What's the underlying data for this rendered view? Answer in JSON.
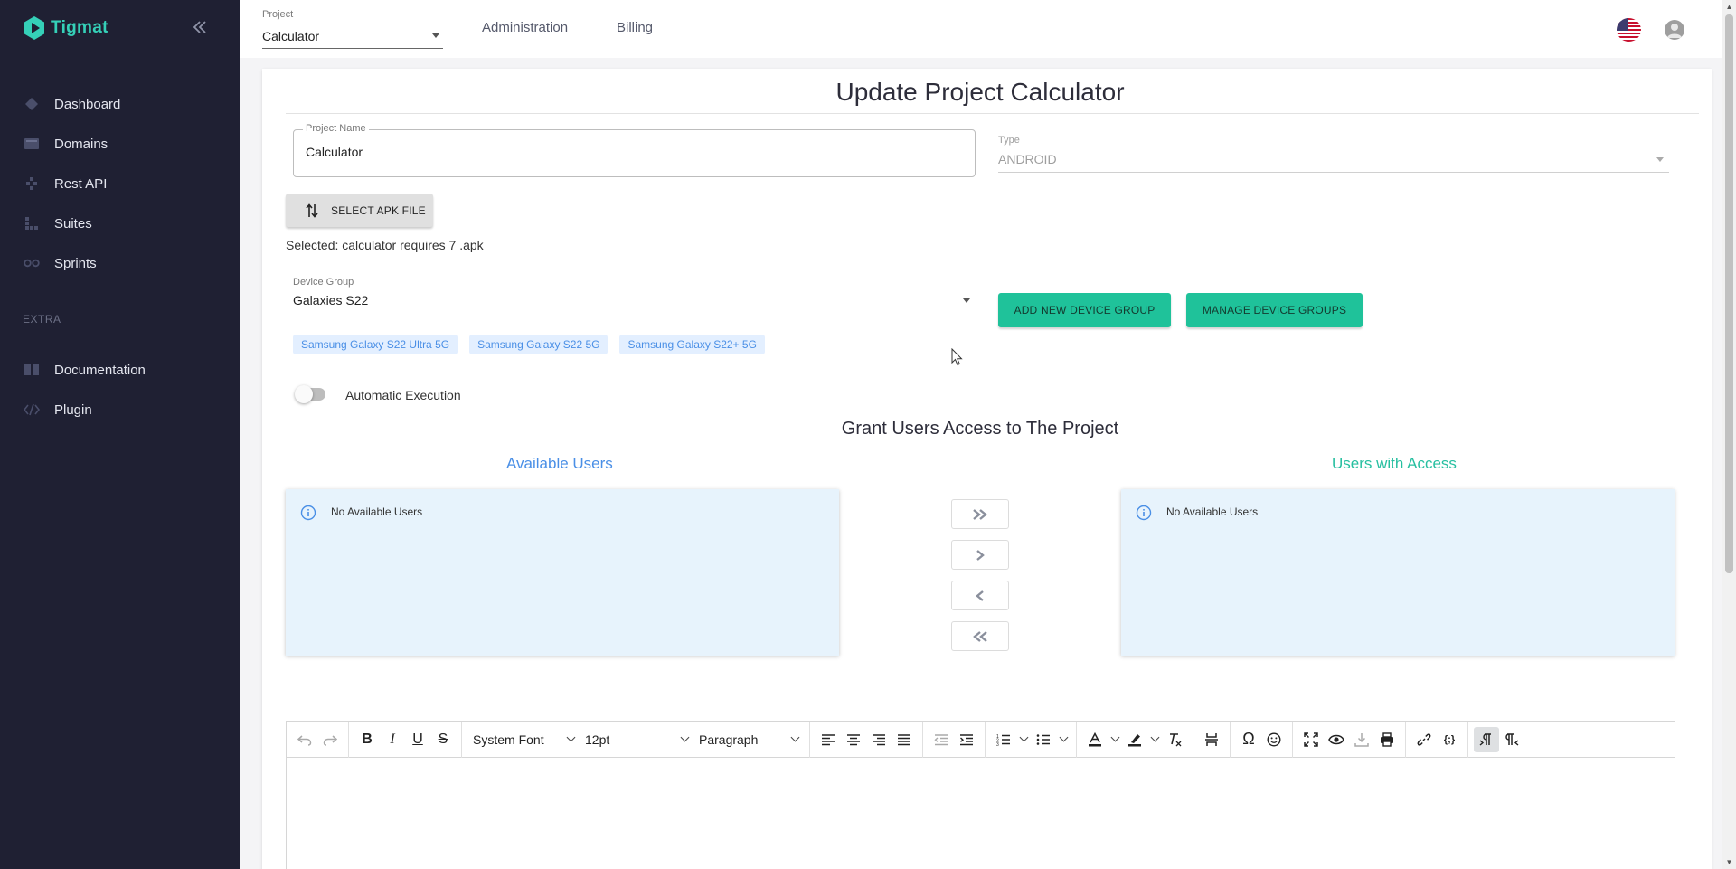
{
  "sidebar": {
    "brand": "Tigmat",
    "items": [
      {
        "label": "Dashboard",
        "icon": "dashboard-icon"
      },
      {
        "label": "Domains",
        "icon": "domains-icon"
      },
      {
        "label": "Rest API",
        "icon": "rest-api-icon"
      },
      {
        "label": "Suites",
        "icon": "suites-icon"
      },
      {
        "label": "Sprints",
        "icon": "sprints-icon"
      }
    ],
    "section_label": "EXTRA",
    "extra_items": [
      {
        "label": "Documentation",
        "icon": "documentation-icon"
      },
      {
        "label": "Plugin",
        "icon": "plugin-icon"
      }
    ]
  },
  "topbar": {
    "project_label": "Project",
    "project_value": "Calculator",
    "links": [
      "Administration",
      "Billing"
    ]
  },
  "form": {
    "title": "Update Project Calculator",
    "project_name_label": "Project Name",
    "project_name_value": "Calculator",
    "type_label": "Type",
    "type_value": "ANDROID",
    "apk_button": "SELECT APK FILE",
    "selected_file": "Selected: calculator requires 7 .apk",
    "device_group_label": "Device Group",
    "device_group_value": "Galaxies S22",
    "add_group_button": "ADD NEW DEVICE GROUP",
    "manage_groups_button": "MANAGE DEVICE GROUPS",
    "devices": [
      "Samsung Galaxy S22 Ultra 5G",
      "Samsung Galaxy S22 5G",
      "Samsung Galaxy S22+ 5G"
    ],
    "auto_execution_label": "Automatic Execution",
    "auto_execution_on": false
  },
  "access": {
    "title": "Grant Users Access to The Project",
    "available_title": "Available Users",
    "with_access_title": "Users with Access",
    "available_empty": "No Available Users",
    "with_access_empty": "No Available Users"
  },
  "editor": {
    "font_family": "System Font",
    "font_size": "12pt",
    "block_format": "Paragraph"
  },
  "colors": {
    "sidebar_bg": "#1f2033",
    "accent_green": "#1fc29a",
    "brand_teal": "#35d0b8",
    "available_title": "#4a8fe6",
    "with_access_title": "#26bfa0",
    "list_bg": "#e7f3fc"
  }
}
